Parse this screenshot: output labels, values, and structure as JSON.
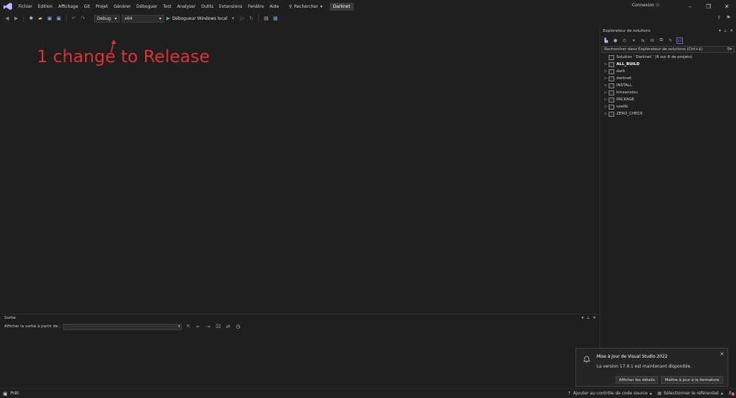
{
  "menubar": {
    "items": [
      "Fichier",
      "Edition",
      "Affichage",
      "Git",
      "Projet",
      "Générer",
      "Déboguer",
      "Test",
      "Analyser",
      "Outils",
      "Extensions",
      "Fenêtre",
      "Aide"
    ],
    "search_label": "Rechercher",
    "solution_name": "Darknet",
    "connexion": "Connexion"
  },
  "toolbar": {
    "config": "Debug",
    "platform": "x64",
    "debugger": "Débogueur Windows local"
  },
  "annotation": {
    "text": "1 change to Release",
    "color": "#e03030"
  },
  "solution_explorer": {
    "title": "Explorateur de solutions",
    "search_placeholder": "Rechercher dans Explorateur de solutions (Ctrl+$)",
    "solution_label": "Solution ' Darknet ' (8 sur 8 de projets)",
    "projects": [
      "ALL_BUILD",
      "dark",
      "darknet",
      "INSTALL",
      "kmeansiou",
      "PACKAGE",
      "uselib",
      "ZERO_CHECK"
    ]
  },
  "output": {
    "title": "Sortie",
    "show_from_label": "Afficher la sortie à partir de :"
  },
  "toast": {
    "title": "Mise à jour de Visual Studio 2022",
    "body": "La version 17.9.1 est maintenant disponible.",
    "details_button": "Afficher les détails",
    "update_button": "Mettre à jour à la fermeture"
  },
  "statusbar": {
    "ready": "Prêt",
    "source_control": "Ajouter au contrôle de code source",
    "repository": "Sélectionner le référentiel",
    "notifications_count": "1"
  },
  "colors": {
    "accent_purple": "#7160e8",
    "play_green": "#3fb950"
  }
}
